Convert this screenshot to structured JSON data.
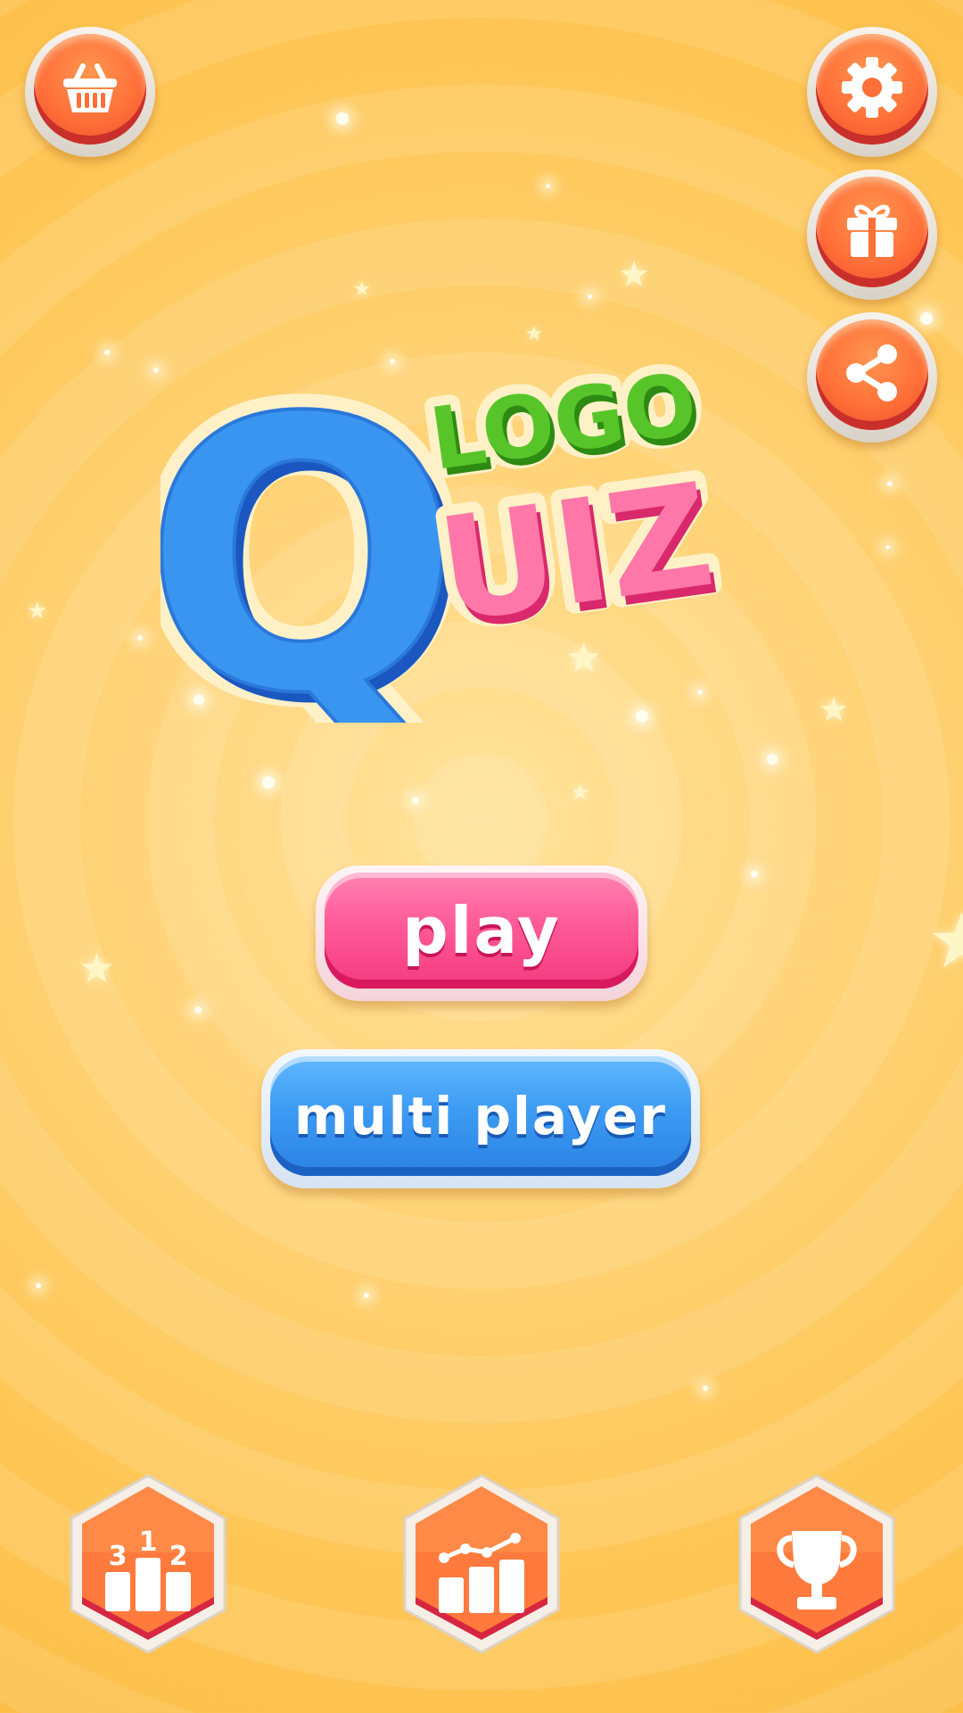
{
  "logo": {
    "big_letter": "Q",
    "top_word": "LOGO",
    "bottom_word": "UIZ"
  },
  "buttons": {
    "play_label": "play",
    "multiplayer_label": "multi player"
  },
  "podium": {
    "left_place": "3",
    "center_place": "1",
    "right_place": "2"
  },
  "icons": {
    "shop": "basket-icon",
    "settings": "gear-icon",
    "gift": "gift-icon",
    "share": "share-icon",
    "leaderboard": "podium-icon",
    "stats": "bar-chart-icon",
    "achievements": "trophy-icon"
  },
  "colors": {
    "background": "#ffd47a",
    "round_button": "#ff6f38",
    "play_pink": "#ff5a98",
    "multi_blue": "#3d9bf4",
    "logo_blue": "#2f86e8",
    "logo_green": "#4dc21e",
    "logo_pink": "#ff6fa2"
  }
}
